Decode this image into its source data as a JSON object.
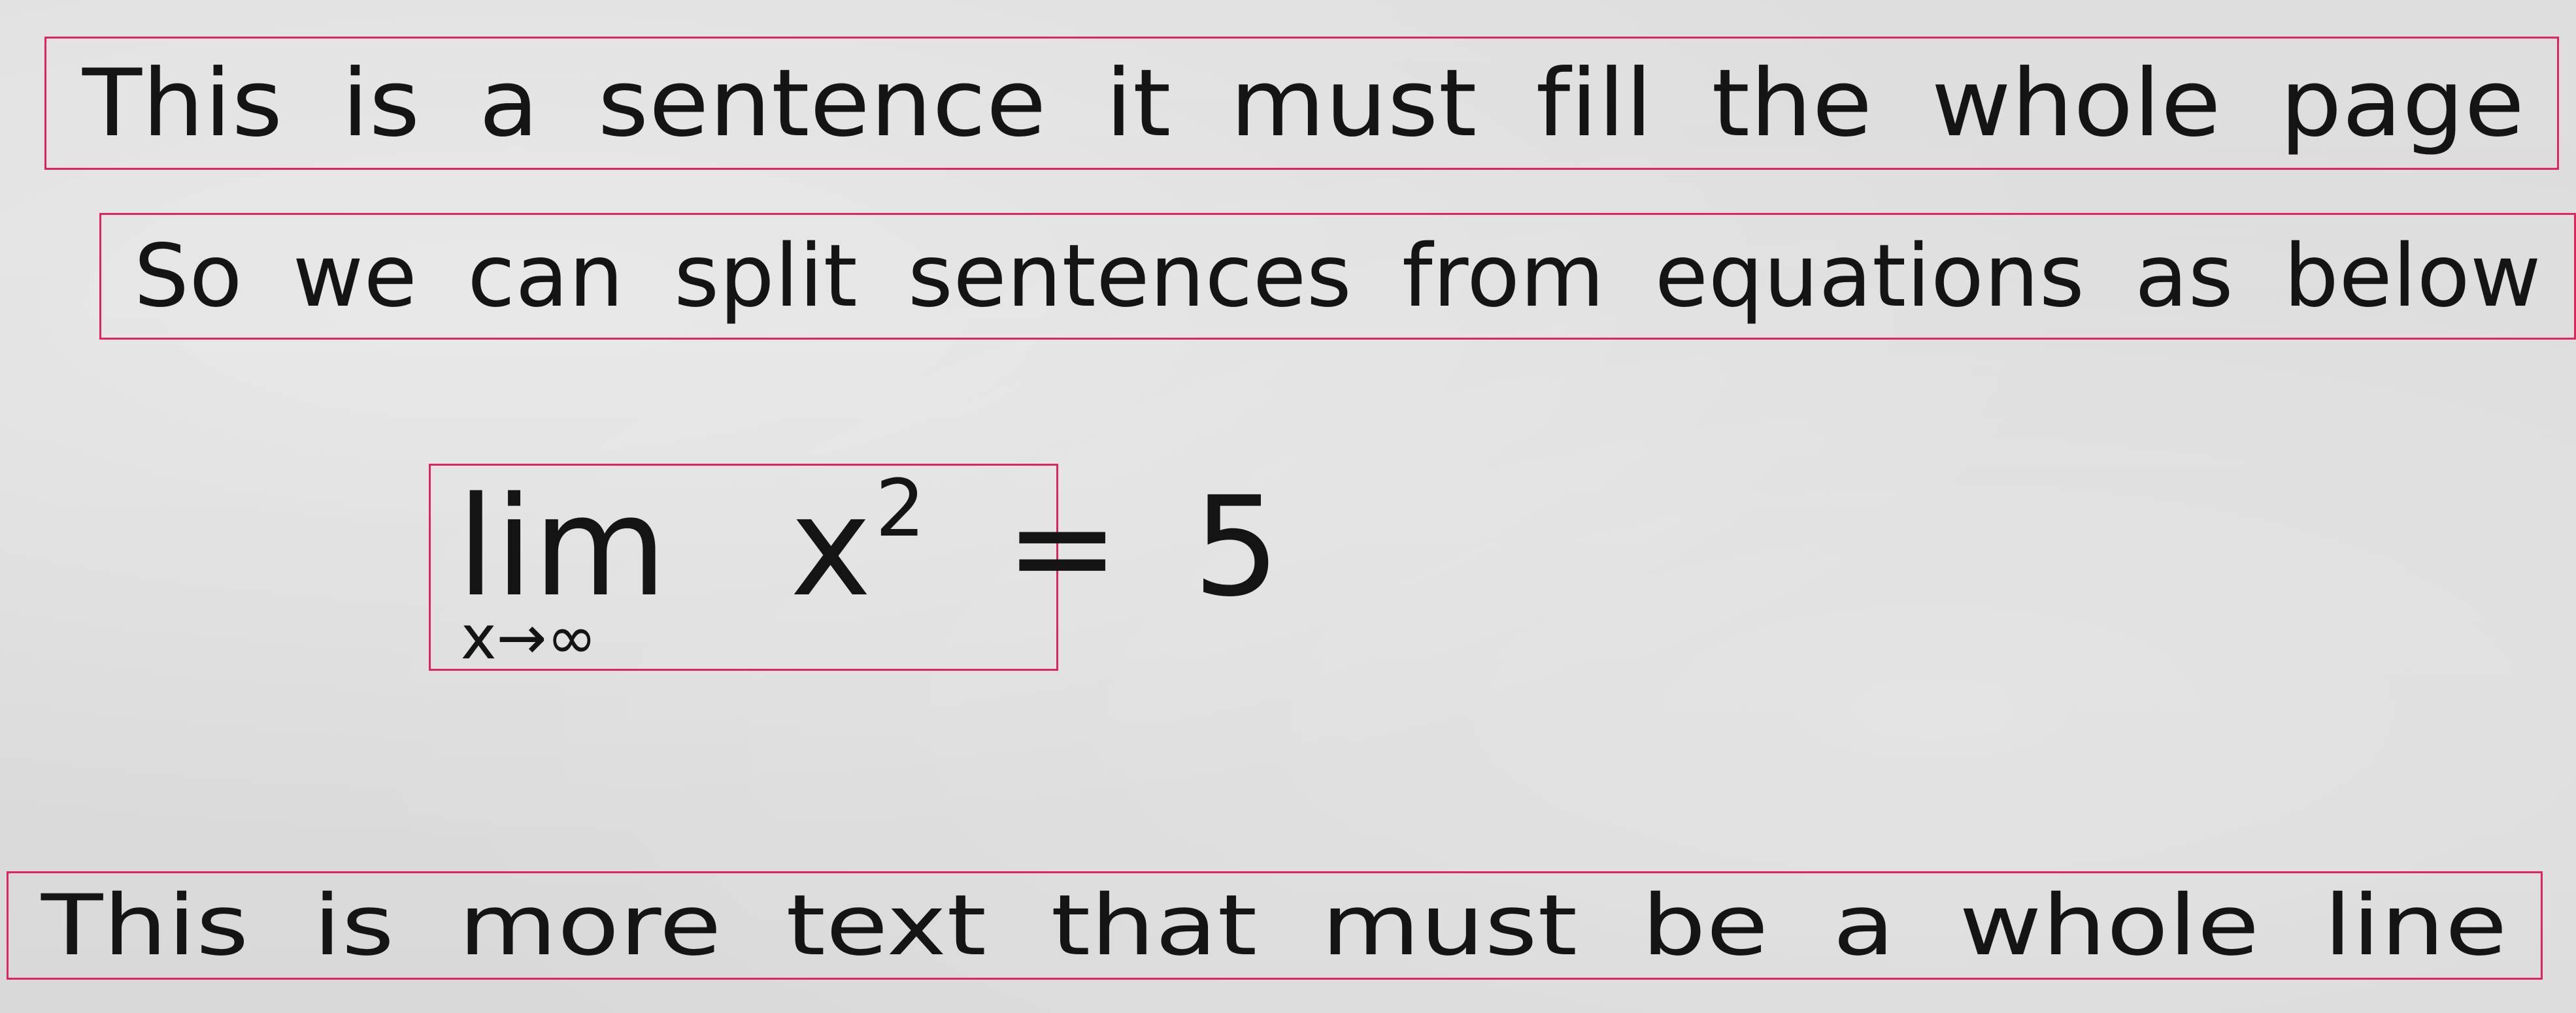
{
  "lines": [
    "This is a sentence it must fill the whole page",
    "So we can split sentences from equations as below"
  ],
  "equation": {
    "operator": "lim",
    "subscript": "x→∞",
    "base": "x",
    "exponent": "2",
    "equals": "=",
    "result": "5"
  },
  "last_line": "This is more text that must be a whole line",
  "colors": {
    "box_border": "#e0245e",
    "paper": "#dcdcdc",
    "ink": "#141414"
  }
}
